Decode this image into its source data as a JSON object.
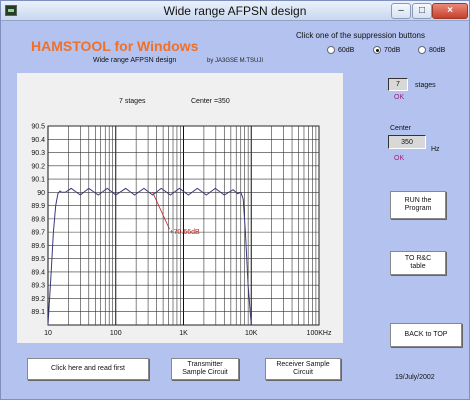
{
  "window": {
    "title": "Wide range AFPSN design",
    "minimize": "–",
    "maximize": "□",
    "close": "×"
  },
  "header": {
    "brand": "HAMSTOOL for Windows",
    "subtitle": "Wide range AFPSN design",
    "author": "by JA3GSE M.TSUJI"
  },
  "suppression": {
    "label": "Click one of the suppression buttons",
    "options": [
      "60dB",
      "70dB",
      "80dB"
    ],
    "selected": "70dB"
  },
  "graph": {
    "stages_text": "7 stages",
    "center_text": "Center =350",
    "marker_label": "+70.66dB"
  },
  "controls": {
    "stages_value": "7",
    "stages_label": "stages",
    "stages_ok": "OK",
    "center_label": "Center",
    "center_value": "350",
    "center_unit": "Hz",
    "center_ok": "OK",
    "run_label_1": "RUN the",
    "run_label_2": "Program",
    "torc_label_1": "TO R&C",
    "torc_label_2": "table",
    "back_label": "BACK to TOP"
  },
  "bottom": {
    "read_first": "Click here and read first",
    "tx_1": "Transmitter",
    "tx_2": "Sample Circuit",
    "rx_1": "Receiver Sample",
    "rx_2": "Circuit",
    "date": "19/July/2002"
  },
  "chart_data": {
    "type": "line",
    "title": "",
    "xlabel": "",
    "ylabel": "",
    "x_scale": "log",
    "xlim": [
      10,
      100000
    ],
    "ylim": [
      89,
      90.5
    ],
    "grid": true,
    "x_tick_labels": [
      "10",
      "100",
      "1K",
      "10K",
      "100KHz"
    ],
    "y_tick_labels": [
      "90.5",
      "90.4",
      "90.3",
      "90.2",
      "90.1",
      "90",
      "89.9",
      "89.8",
      "89.7",
      "89.6",
      "89.5",
      "89.4",
      "89.3",
      "89.2",
      "89.1"
    ],
    "series": [
      {
        "color": "#3a3a7a",
        "x": [
          10,
          11,
          12,
          13,
          14,
          15,
          16,
          18,
          22,
          30,
          40,
          55,
          75,
          100,
          140,
          190,
          260,
          350,
          470,
          640,
          870,
          1180,
          1600,
          2170,
          2950,
          4000,
          5400,
          6300,
          7000,
          7600,
          8200,
          9000,
          10000
        ],
        "y": [
          89.0,
          89.35,
          89.7,
          89.9,
          89.99,
          90.01,
          90.0,
          90.0,
          90.03,
          89.98,
          90.03,
          89.98,
          90.03,
          89.98,
          90.03,
          89.98,
          90.03,
          89.98,
          90.03,
          89.98,
          90.03,
          89.98,
          90.03,
          89.98,
          90.03,
          89.98,
          90.02,
          89.99,
          90.0,
          89.95,
          89.7,
          89.3,
          89.0
        ]
      }
    ],
    "marker": {
      "x": 350,
      "y": 90.0,
      "label_x": 1000,
      "label_y": 89.7
    }
  }
}
